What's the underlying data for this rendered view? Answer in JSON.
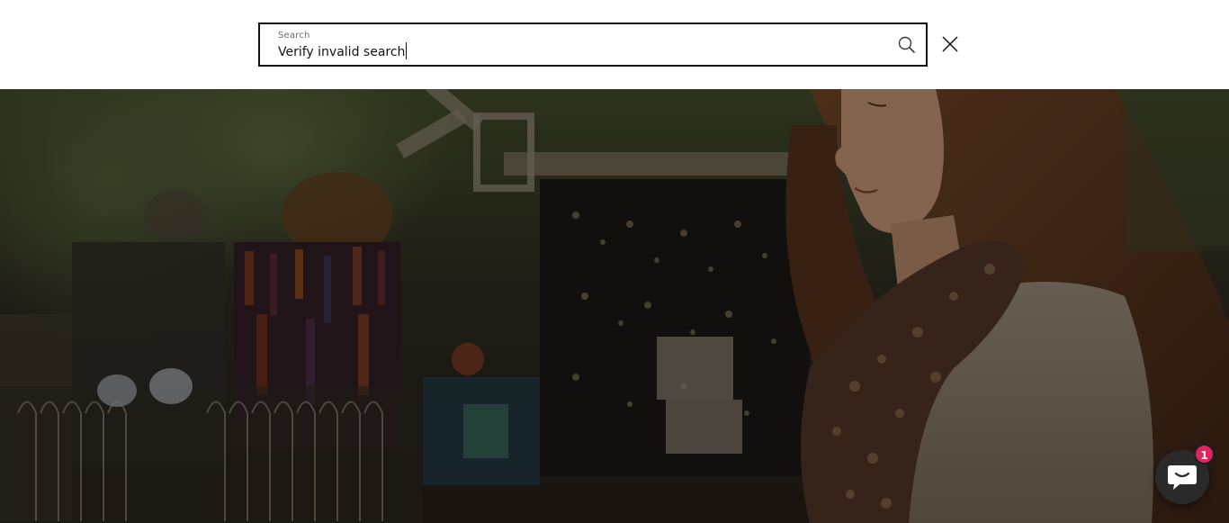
{
  "search": {
    "label": "Search",
    "value": "Verify invalid search",
    "placeholder": "Search"
  },
  "icons": {
    "search": "search-icon",
    "close": "close-icon",
    "chat": "chat-icon"
  },
  "chat": {
    "unread_count": "1",
    "badge_color": "#e0245e"
  },
  "colors": {
    "border": "#121212",
    "background": "#ffffff"
  }
}
